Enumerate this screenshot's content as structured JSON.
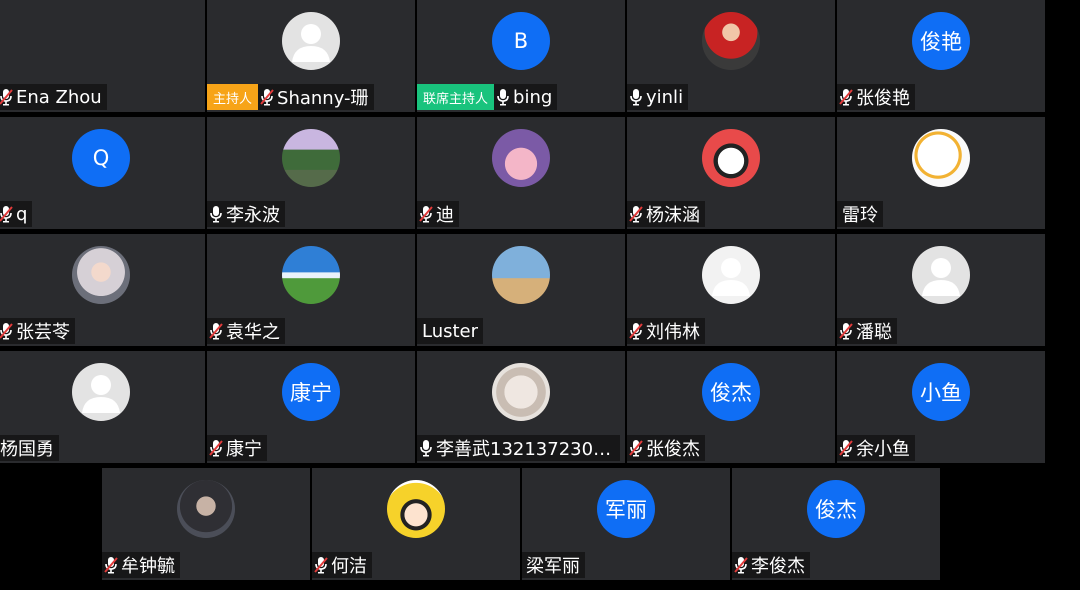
{
  "participants": [
    {
      "name": "Ena Zhou",
      "avatar": "none",
      "mic": "muted"
    },
    {
      "name": "Shanny-珊",
      "avatar": "person",
      "mic": "muted",
      "badge": "主持人",
      "badge_color": "#f7a418"
    },
    {
      "name": "bing",
      "avatar": "letter",
      "avatar_text": "B",
      "mic": "on",
      "badge": "联席主持人",
      "badge_color": "#19c37d"
    },
    {
      "name": "yinli",
      "avatar": "photo",
      "mic": "on"
    },
    {
      "name": "张俊艳",
      "avatar": "letter",
      "avatar_text": "俊艳",
      "mic": "muted"
    },
    {
      "name": "q",
      "avatar": "letter",
      "avatar_text": "Q",
      "mic": "muted"
    },
    {
      "name": "李永波",
      "avatar": "photo",
      "mic": "on"
    },
    {
      "name": "迪",
      "avatar": "photo",
      "mic": "muted"
    },
    {
      "name": "杨沫涵",
      "avatar": "photo",
      "mic": "muted"
    },
    {
      "name": "雷玲",
      "avatar": "photo",
      "mic": "none"
    },
    {
      "name": "张芸苓",
      "avatar": "photo",
      "mic": "muted"
    },
    {
      "name": "袁华之",
      "avatar": "photo",
      "mic": "muted"
    },
    {
      "name": "Luster",
      "avatar": "photo",
      "mic": "none"
    },
    {
      "name": "刘伟林",
      "avatar": "person",
      "mic": "muted"
    },
    {
      "name": "潘聪",
      "avatar": "person",
      "mic": "muted"
    },
    {
      "name": "杨国勇",
      "avatar": "person",
      "mic": "none"
    },
    {
      "name": "康宁",
      "avatar": "letter",
      "avatar_text": "康宁",
      "mic": "muted"
    },
    {
      "name": "李善武1321372303…",
      "avatar": "photo",
      "mic": "on"
    },
    {
      "name": "张俊杰",
      "avatar": "letter",
      "avatar_text": "俊杰",
      "mic": "muted"
    },
    {
      "name": "余小鱼",
      "avatar": "letter",
      "avatar_text": "小鱼",
      "mic": "muted"
    },
    {
      "name": "牟钟毓",
      "avatar": "photo",
      "mic": "muted"
    },
    {
      "name": "何洁",
      "avatar": "photo",
      "mic": "muted"
    },
    {
      "name": "梁军丽",
      "avatar": "letter",
      "avatar_text": "军丽",
      "mic": "none"
    },
    {
      "name": "李俊杰",
      "avatar": "letter",
      "avatar_text": "俊杰",
      "mic": "muted"
    }
  ],
  "colors": {
    "tile": "#2a2b2e",
    "letter_avatar": "#0f6ef5",
    "host": "#f7a418",
    "cohost": "#19c37d"
  }
}
